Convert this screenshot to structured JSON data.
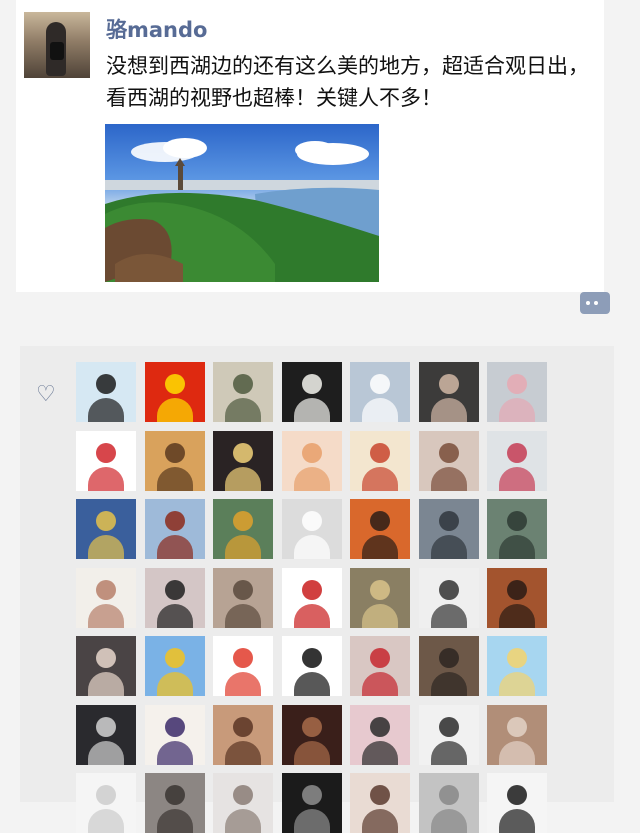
{
  "post": {
    "username": "骆mando",
    "caption": "没想到西湖边的还有这么美的地方，超适合观日出，看西湖的视野也超棒！关键人不多！",
    "photo_icon": "west-lake-photo"
  },
  "likes": {
    "heart_icon": "heart-icon",
    "avatars": [
      {
        "name": "avatar-cartoon-girl-glasses",
        "bg": "#d6e8f3",
        "fg": "#1b1b1b"
      },
      {
        "name": "avatar-china-flag",
        "bg": "#de2910",
        "fg": "#ffde00"
      },
      {
        "name": "avatar-person-outdoor",
        "bg": "#cfc9b8",
        "fg": "#4f5a3e"
      },
      {
        "name": "avatar-calla-lily",
        "bg": "#1e1e1e",
        "fg": "#f4f4ef"
      },
      {
        "name": "avatar-girl-white-dress",
        "bg": "#b9c7d6",
        "fg": "#ffffff"
      },
      {
        "name": "avatar-girl-portrait",
        "bg": "#3c3b3a",
        "fg": "#d1b8a6"
      },
      {
        "name": "avatar-pink-fish",
        "bg": "#c7ccd2",
        "fg": "#e6a8b3"
      },
      {
        "name": "avatar-strawberry",
        "bg": "#ffffff",
        "fg": "#d0262c"
      },
      {
        "name": "avatar-desert-person",
        "bg": "#d9a25c",
        "fg": "#5a3a1e"
      },
      {
        "name": "avatar-hello-kitty-lights",
        "bg": "#2a2324",
        "fg": "#f2d27a"
      },
      {
        "name": "avatar-anime-girls",
        "bg": "#f5dbc8",
        "fg": "#e79f6a"
      },
      {
        "name": "avatar-flowers-text",
        "bg": "#f3e6cf",
        "fg": "#c8452e"
      },
      {
        "name": "avatar-girl-long-hair",
        "bg": "#d8c7bd",
        "fg": "#7a4d3a"
      },
      {
        "name": "avatar-woman-traditional",
        "bg": "#dfe3e6",
        "fg": "#c63c54"
      },
      {
        "name": "avatar-soccer-player",
        "bg": "#3a5f9c",
        "fg": "#e6c24b"
      },
      {
        "name": "avatar-red-tower",
        "bg": "#9ebad9",
        "fg": "#8c2a1a"
      },
      {
        "name": "avatar-flower-field",
        "bg": "#5b7f5a",
        "fg": "#e0a12d"
      },
      {
        "name": "avatar-white-cat",
        "bg": "#dcdcdc",
        "fg": "#ffffff"
      },
      {
        "name": "avatar-sunset-person",
        "bg": "#d9682c",
        "fg": "#2b1e17"
      },
      {
        "name": "avatar-city-lake",
        "bg": "#7b8692",
        "fg": "#30363d"
      },
      {
        "name": "avatar-canal-bridge",
        "bg": "#6b8272",
        "fg": "#2d3a33"
      },
      {
        "name": "avatar-sketch-girl",
        "bg": "#f2efea",
        "fg": "#b77f6a"
      },
      {
        "name": "avatar-girl-glasses",
        "bg": "#d4c6c6",
        "fg": "#1f1f1f"
      },
      {
        "name": "avatar-cat-kid",
        "bg": "#b7a394",
        "fg": "#5b4a3d"
      },
      {
        "name": "avatar-paper-cut",
        "bg": "#ffffff",
        "fg": "#c91d1d"
      },
      {
        "name": "avatar-street-collage",
        "bg": "#8a7f63",
        "fg": "#d9c38a"
      },
      {
        "name": "avatar-girl-sketch",
        "bg": "#efefef",
        "fg": "#333333"
      },
      {
        "name": "avatar-illustrated-girl",
        "bg": "#a3542e",
        "fg": "#2a1b14"
      },
      {
        "name": "avatar-woman-dark",
        "bg": "#4a4445",
        "fg": "#e8d7cc"
      },
      {
        "name": "avatar-sunflower",
        "bg": "#7ab2e6",
        "fg": "#f3c21d"
      },
      {
        "name": "avatar-lion-dance",
        "bg": "#ffffff",
        "fg": "#e03b2b"
      },
      {
        "name": "avatar-mask",
        "bg": "#ffffff",
        "fg": "#111111"
      },
      {
        "name": "avatar-girl-red-flower",
        "bg": "#d9c7c3",
        "fg": "#c5272f"
      },
      {
        "name": "avatar-person-doorway",
        "bg": "#6d5848",
        "fg": "#2e2622"
      },
      {
        "name": "avatar-cartoon-couple",
        "bg": "#a7d6f0",
        "fg": "#f3d36d"
      },
      {
        "name": "avatar-night-street",
        "bg": "#2a2a2e",
        "fg": "#d2d2d2"
      },
      {
        "name": "avatar-calligraphy",
        "bg": "#f5f1ec",
        "fg": "#3b2a6a"
      },
      {
        "name": "avatar-girl-back",
        "bg": "#c89a7a",
        "fg": "#5a3524"
      },
      {
        "name": "avatar-dark-cafe",
        "bg": "#3a1f1a",
        "fg": "#a86b4a"
      },
      {
        "name": "avatar-girl-pink",
        "bg": "#e7c9cf",
        "fg": "#2a2a2a"
      },
      {
        "name": "avatar-boy-portrait",
        "bg": "#f1f1f1",
        "fg": "#2b2b2b"
      },
      {
        "name": "avatar-group-photo",
        "bg": "#b18e78",
        "fg": "#e3d2c6"
      },
      {
        "name": "avatar-white-partial",
        "bg": "#f5f5f5",
        "fg": "#cccccc"
      },
      {
        "name": "avatar-dim-room",
        "bg": "#8c8683",
        "fg": "#3a3532"
      },
      {
        "name": "avatar-pale-figure",
        "bg": "#e6e3e2",
        "fg": "#8a7d76"
      },
      {
        "name": "avatar-black-partial",
        "bg": "#1b1b1b",
        "fg": "#8e8e8e"
      },
      {
        "name": "avatar-girl-light",
        "bg": "#e9dbd3",
        "fg": "#5a3a2e"
      },
      {
        "name": "avatar-gray-partial",
        "bg": "#c3c3c3",
        "fg": "#888888"
      },
      {
        "name": "avatar-rose-drawing",
        "bg": "#f5f5f5",
        "fg": "#1a1a1a"
      }
    ]
  }
}
